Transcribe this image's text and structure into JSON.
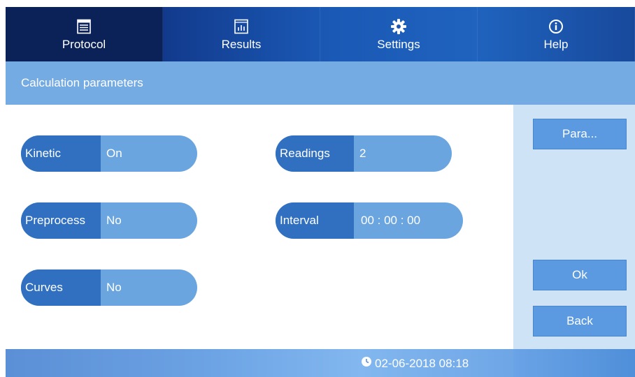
{
  "nav": {
    "tabs": [
      {
        "label": "Protocol",
        "icon": "protocol-icon",
        "active": true
      },
      {
        "label": "Results",
        "icon": "results-chart-icon",
        "active": false
      },
      {
        "label": "Settings",
        "icon": "gear-icon",
        "active": false
      },
      {
        "label": "Help",
        "icon": "info-icon",
        "active": false
      }
    ]
  },
  "page": {
    "title": "Calculation parameters"
  },
  "params": {
    "kinetic": {
      "label": "Kinetic",
      "value": "On"
    },
    "preprocess": {
      "label": "Preprocess",
      "value": "No"
    },
    "curves": {
      "label": "Curves",
      "value": "No"
    },
    "readings": {
      "label": "Readings",
      "value": "2"
    },
    "interval": {
      "label": "Interval",
      "value": "00 : 00 : 00"
    }
  },
  "side": {
    "para_label": "Para...",
    "ok_label": "Ok",
    "back_label": "Back"
  },
  "status": {
    "datetime": "02-06-2018 08:18"
  },
  "colors": {
    "nav_dark": "#0a2258",
    "title_strip": "#74abe3",
    "pill_key": "#3170c0",
    "pill_value": "#6aa5e0",
    "side_panel": "#cfe3f6",
    "side_button": "#5b9ae0"
  }
}
